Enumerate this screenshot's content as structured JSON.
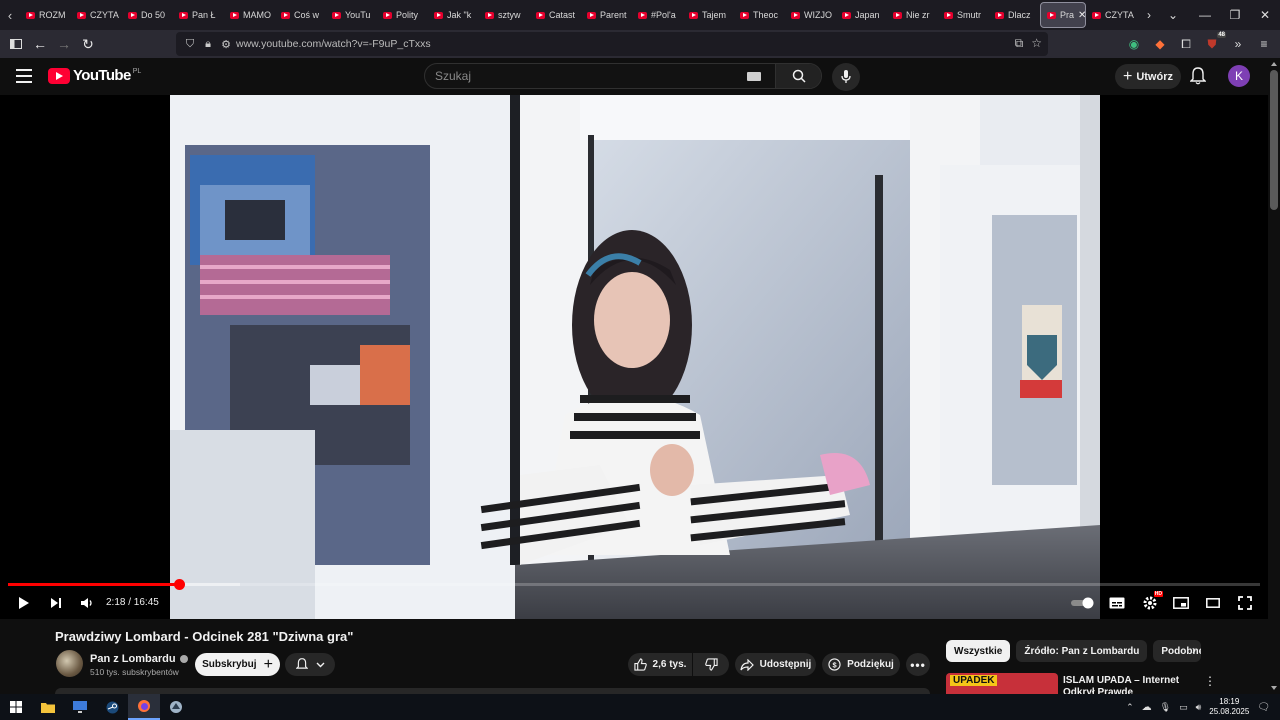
{
  "browser": {
    "tabs": [
      {
        "label": "ROZM"
      },
      {
        "label": "CZYTA"
      },
      {
        "label": "Do 50"
      },
      {
        "label": "Pan Ł"
      },
      {
        "label": "MAMO"
      },
      {
        "label": "Coś w"
      },
      {
        "label": "YouTu"
      },
      {
        "label": "Polity"
      },
      {
        "label": "Jak \"k"
      },
      {
        "label": "sztyw"
      },
      {
        "label": "Catast"
      },
      {
        "label": "Parent"
      },
      {
        "label": "#Pol'a"
      },
      {
        "label": "Tajem"
      },
      {
        "label": "Theoc"
      },
      {
        "label": "WIZJO"
      },
      {
        "label": "Japan"
      },
      {
        "label": "Nie zr"
      },
      {
        "label": "Smutr"
      },
      {
        "label": "Dlacz"
      }
    ],
    "active_tab": {
      "label": "Pra"
    },
    "after_tab": {
      "label": "CZYTA"
    },
    "url": "www.youtube.com/watch?v=-F9uP_cTxxs",
    "extension_badge": "48"
  },
  "youtube": {
    "logo_text": "YouTube",
    "country_code": "PL",
    "search_placeholder": "Szukaj",
    "create_label": "Utwórz",
    "avatar_letter": "K",
    "accent": "#ff0033"
  },
  "player": {
    "current_time": "2:18",
    "duration": "16:45",
    "time_display": "2:18 / 16:45",
    "played_fraction": 0.1373,
    "buffered_fraction": 0.185,
    "hd_badge": "HD"
  },
  "video": {
    "title": "Prawdziwy Lombard - Odcinek 281 \"Dziwna gra\"",
    "channel": "Pan z Lombardu",
    "subscribers": "510 tys. subskrybentów",
    "subscribe_label": "Subskrybuj",
    "likes": "2,6 tys.",
    "share_label": "Udostępnij",
    "thanks_label": "Podziękuj"
  },
  "sidebar": {
    "chips": [
      {
        "label": "Wszystkie",
        "active": true
      },
      {
        "label": "Źródło: Pan z Lombardu",
        "active": false
      },
      {
        "label": "Podobne",
        "active": false
      }
    ],
    "recommendation": {
      "thumb_text": "UPADEK",
      "title": "ISLAM UPADA – Internet Odkrył Prawdę"
    }
  },
  "taskbar": {
    "time": "18:19",
    "date": "25.08.2025"
  }
}
